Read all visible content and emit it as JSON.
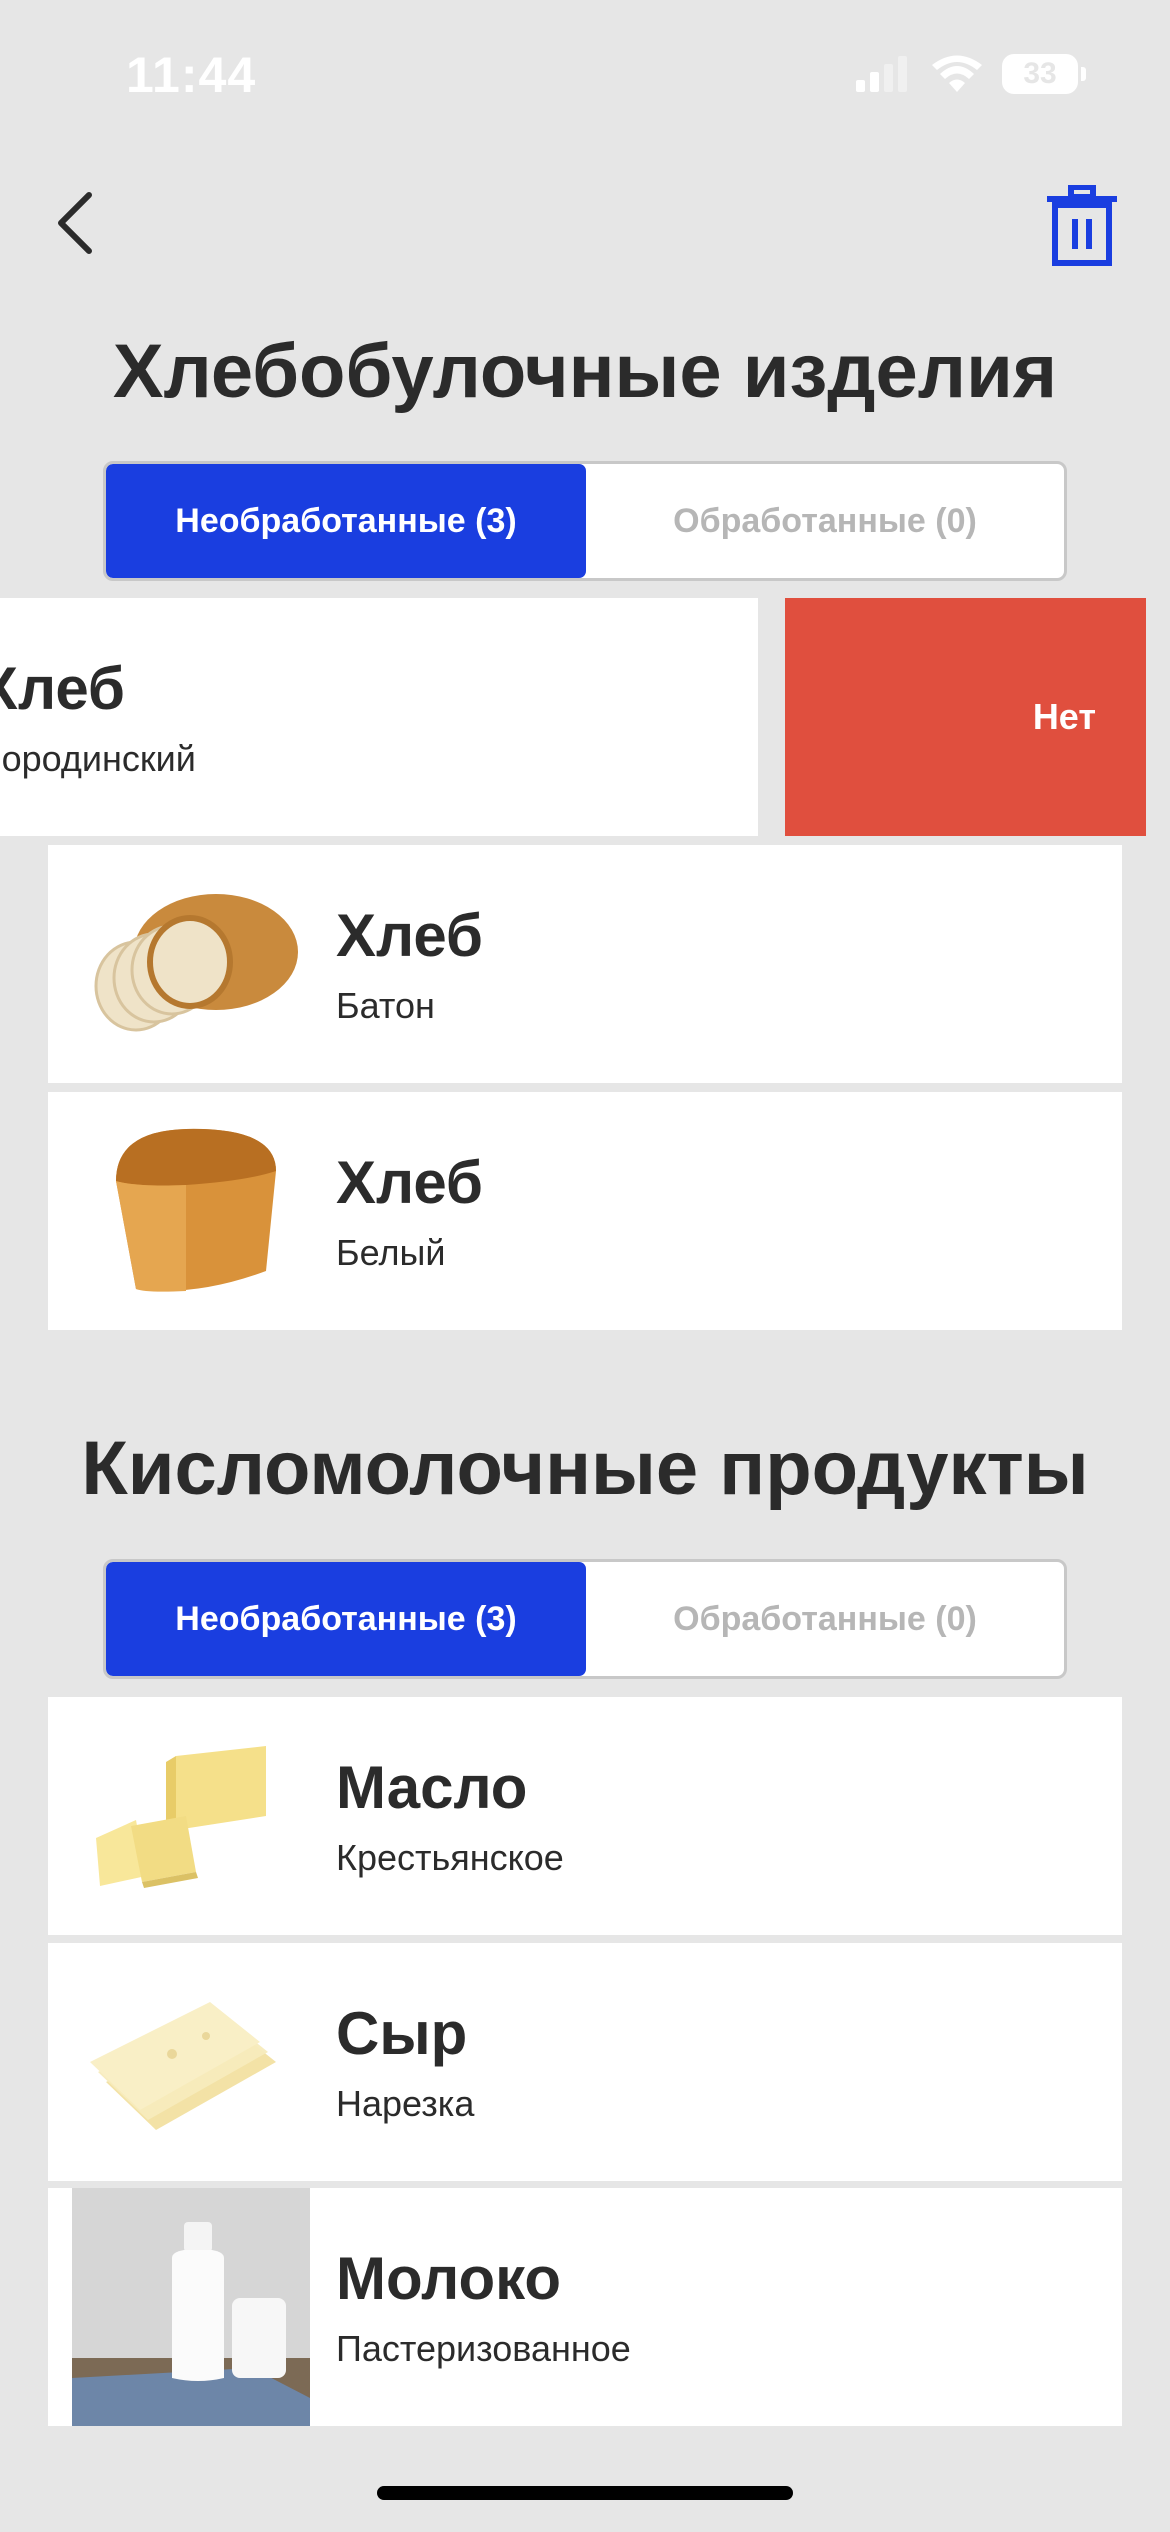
{
  "status_bar": {
    "time": "11:44",
    "battery": "33"
  },
  "nav": {
    "back_icon": "chevron-left-icon",
    "trash_icon": "trash-icon",
    "accent": "#1a3ee0"
  },
  "sections": [
    {
      "title": "Хлебобулочные изделия",
      "tabs": [
        {
          "label": "Необработанные (3)"
        },
        {
          "label": "Обработанные (0)"
        }
      ],
      "items": [
        {
          "title": "Хлеб",
          "subtitle": "Бородинский",
          "action_label": "Нет"
        },
        {
          "title": "Хлеб",
          "subtitle": "Батон"
        },
        {
          "title": "Хлеб",
          "subtitle": "Белый"
        }
      ]
    },
    {
      "title": "Кисломолочные продукты",
      "tabs": [
        {
          "label": "Необработанные (3)"
        },
        {
          "label": "Обработанные (0)"
        }
      ],
      "items": [
        {
          "title": "Масло",
          "subtitle": "Крестьянское"
        },
        {
          "title": "Сыр",
          "subtitle": "Нарезка"
        },
        {
          "title": "Молоко",
          "subtitle": "Пастеризованное"
        }
      ]
    }
  ],
  "colors": {
    "background": "#e6e6e6",
    "primary": "#1a3ee0",
    "delete": "#e04f3e"
  }
}
